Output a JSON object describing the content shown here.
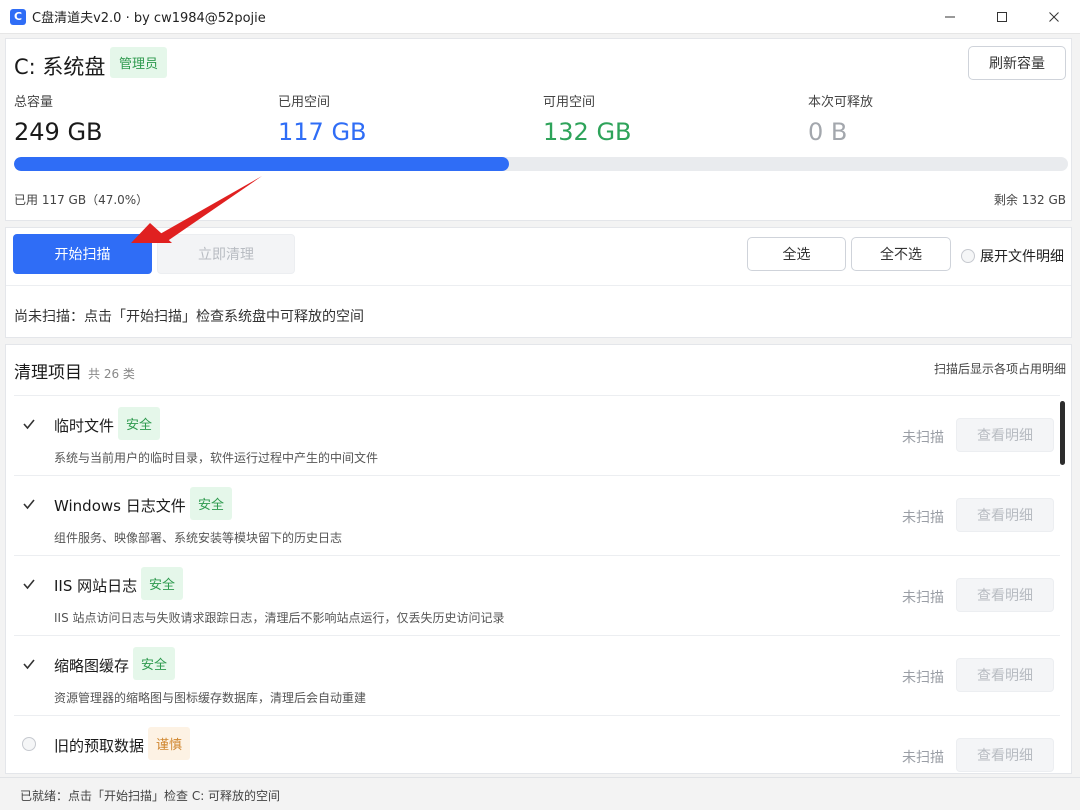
{
  "window": {
    "title": "C盘清道夫v2.0 · by cw1984@52pojie",
    "app_icon_letter": "C",
    "minimize_icon": "minimize-icon",
    "maximize_icon": "maximize-icon",
    "close_icon": "close-icon"
  },
  "disk": {
    "title": "C: 系统盘",
    "admin_badge": "管理员",
    "refresh_label": "刷新容量",
    "stats": {
      "total_label": "总容量",
      "total_value": "249 GB",
      "used_label": "已用空间",
      "used_value": "117 GB",
      "free_label": "可用空间",
      "free_value": "132 GB",
      "release_label": "本次可释放",
      "release_value": "0 B"
    },
    "usage_fraction": 0.47,
    "used_caption": "已用 117 GB（47.0%）",
    "free_caption": "剩余 132 GB"
  },
  "actions": {
    "scan_label": "开始扫描",
    "clean_label": "立即清理",
    "select_all_label": "全选",
    "select_none_label": "全不选",
    "expand_label": "展开文件明细",
    "hint": "尚未扫描：点击「开始扫描」检查系统盘中可释放的空间"
  },
  "list": {
    "title": "清理项目",
    "count": "共 26 类",
    "right_note": "扫描后显示各项占用明细",
    "items": [
      {
        "name": "临时文件",
        "tag": "安全",
        "tag_type": "safe",
        "checked": true,
        "desc": "系统与当前用户的临时目录，软件运行过程中产生的中间文件",
        "status": "未扫描",
        "detail_label": "查看明细"
      },
      {
        "name": "Windows 日志文件",
        "tag": "安全",
        "tag_type": "safe",
        "checked": true,
        "desc": "组件服务、映像部署、系统安装等模块留下的历史日志",
        "status": "未扫描",
        "detail_label": "查看明细"
      },
      {
        "name": "IIS 网站日志",
        "tag": "安全",
        "tag_type": "safe",
        "checked": true,
        "desc": "IIS 站点访问日志与失败请求跟踪日志，清理后不影响站点运行，仅丢失历史访问记录",
        "status": "未扫描",
        "detail_label": "查看明细"
      },
      {
        "name": "缩略图缓存",
        "tag": "安全",
        "tag_type": "safe",
        "checked": true,
        "desc": "资源管理器的缩略图与图标缓存数据库，清理后会自动重建",
        "status": "未扫描",
        "detail_label": "查看明细"
      },
      {
        "name": "旧的预取数据",
        "tag": "谨慎",
        "tag_type": "caution",
        "checked": false,
        "desc": "",
        "status": "未扫描",
        "detail_label": "查看明细"
      }
    ]
  },
  "statusbar": {
    "text": "已就绪：点击「开始扫描」检查 C: 可释放的空间"
  },
  "colors": {
    "accent": "#2f6df6",
    "safe_bg": "#e5f7ea",
    "safe_fg": "#2e9a4e",
    "caution_bg": "#fdf2e4",
    "caution_fg": "#d0862e",
    "annotation_arrow": "#e02020"
  }
}
